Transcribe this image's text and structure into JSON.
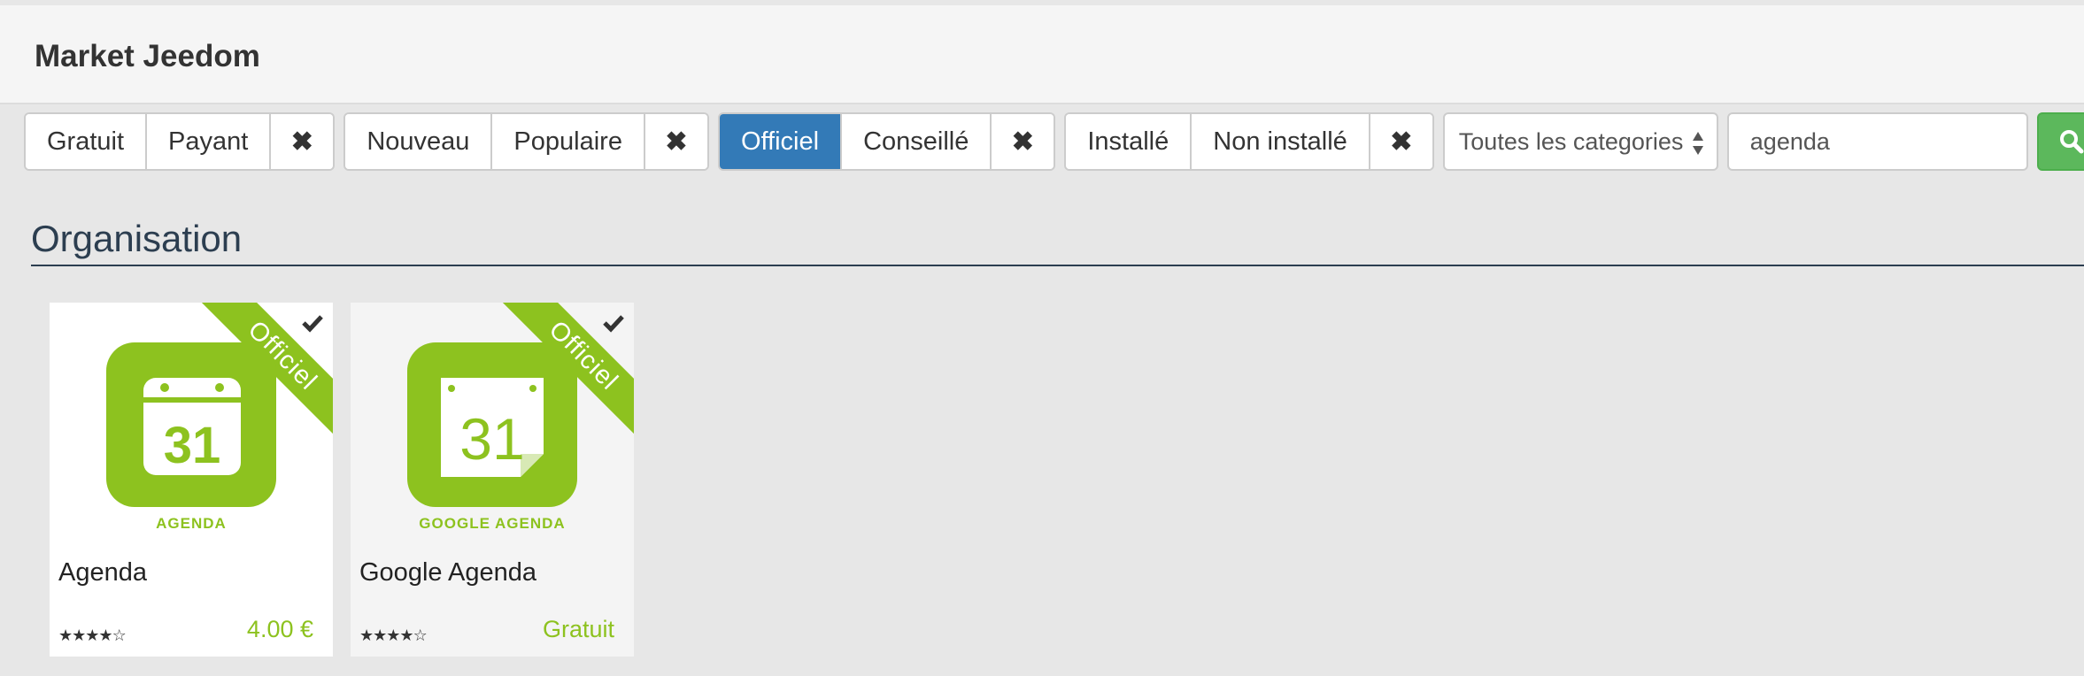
{
  "header": {
    "title": "Market Jeedom"
  },
  "filters": {
    "price": {
      "items": [
        "Gratuit",
        "Payant"
      ],
      "clear_icon": "times-icon"
    },
    "popularity": {
      "items": [
        "Nouveau",
        "Populaire"
      ],
      "clear_icon": "times-icon"
    },
    "certification": {
      "items": [
        "Officiel",
        "Conseillé"
      ],
      "active": "Officiel",
      "clear_icon": "times-icon"
    },
    "install": {
      "items": [
        "Installé",
        "Non installé"
      ],
      "clear_icon": "times-icon"
    },
    "category": {
      "selected": "Toutes les categories"
    },
    "search": {
      "value": "agenda",
      "icon": "search-icon"
    }
  },
  "section": {
    "title": "Organisation"
  },
  "plugins": [
    {
      "name": "Agenda",
      "logo_label": "AGENDA",
      "logo_day": "31",
      "ribbon": "Officiel",
      "installed_icon": "check-icon",
      "rating": 4,
      "rating_max": 5,
      "price": "4.00 €"
    },
    {
      "name": "Google Agenda",
      "logo_label": "GOOGLE AGENDA",
      "logo_day": "31",
      "ribbon": "Officiel",
      "installed_icon": "check-icon",
      "rating": 4,
      "rating_max": 5,
      "price": "Gratuit"
    }
  ],
  "colors": {
    "accent_green": "#8dc21f",
    "active_blue": "#337ab7",
    "search_green": "#5cb85c",
    "section_title": "#2c3e50"
  }
}
